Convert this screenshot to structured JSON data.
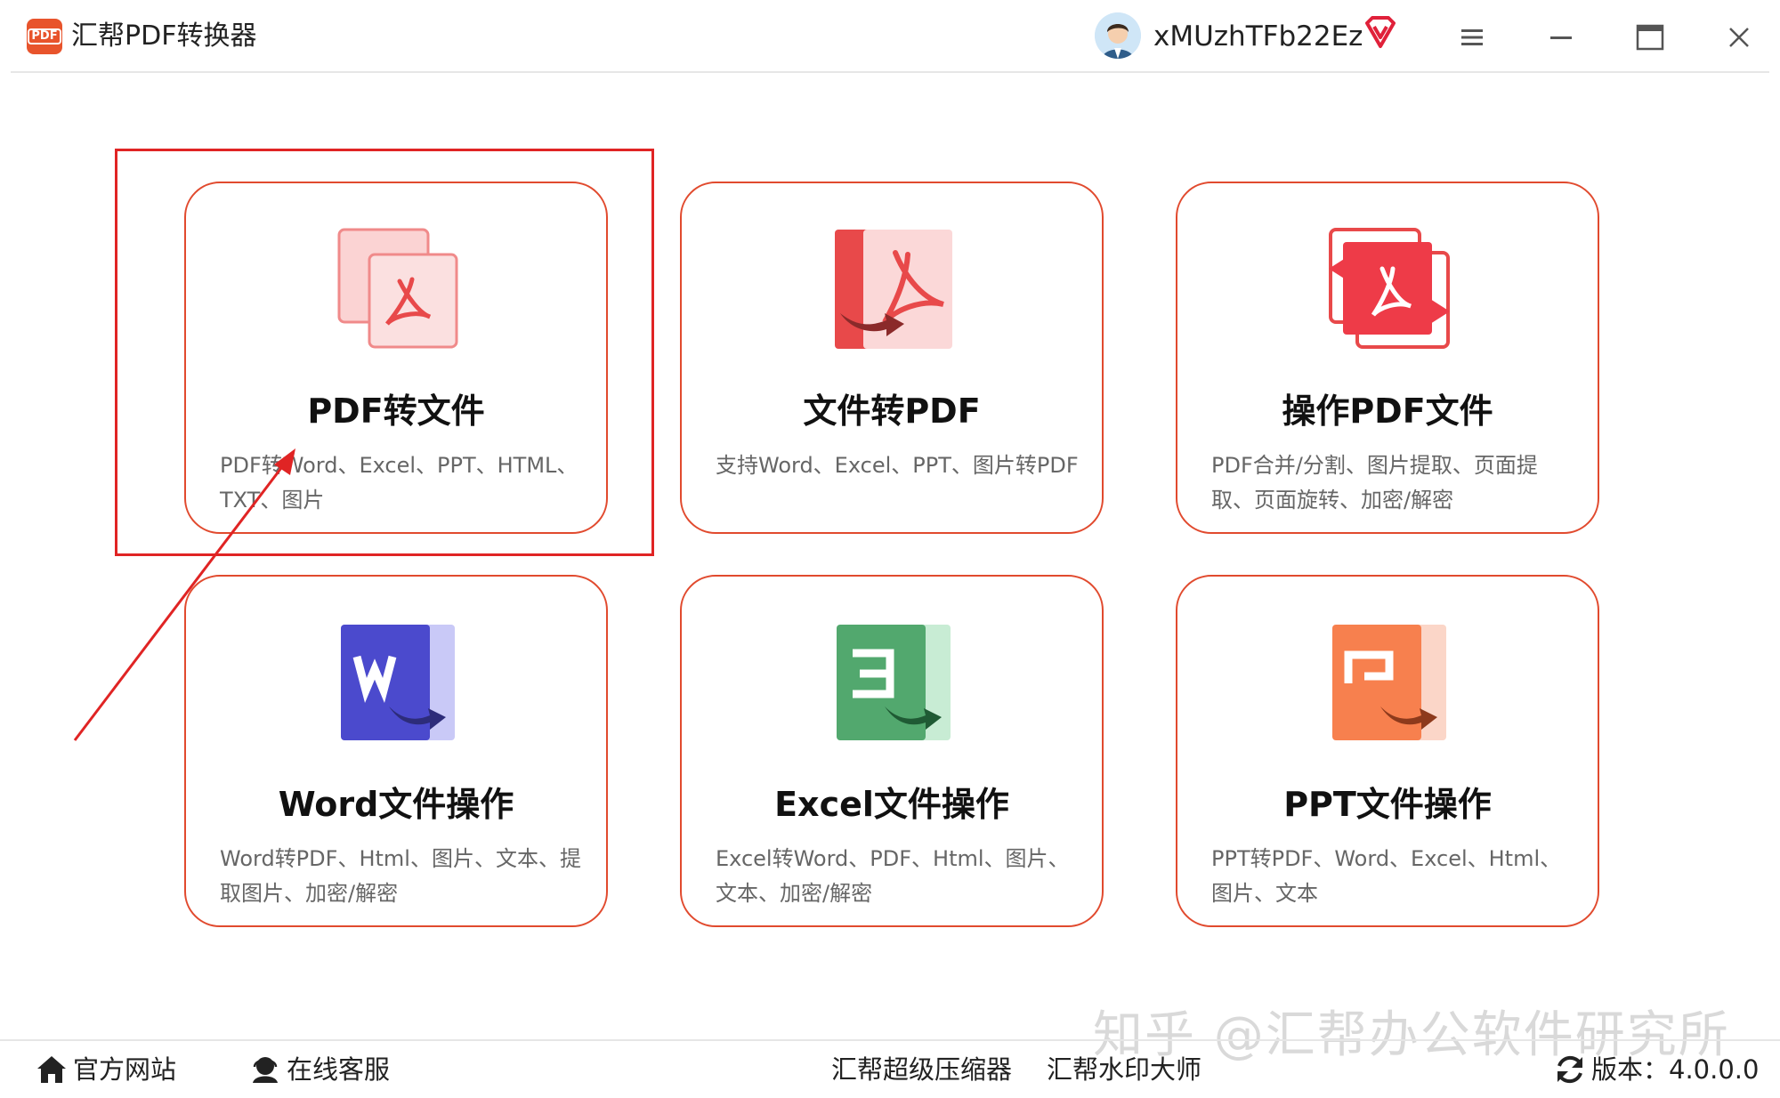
{
  "app": {
    "title": "汇帮PDF转换器",
    "logo_text": "PDF"
  },
  "user": {
    "name": "xMUzhTFb22Ez"
  },
  "window_controls": [
    "menu-icon",
    "minimize-icon",
    "maximize-icon",
    "close-icon"
  ],
  "colors": {
    "accent": "#e14a2e",
    "highlight": "#e02424"
  },
  "cards": [
    {
      "title": "PDF转文件",
      "desc": "PDF转Word、Excel、PPT、HTML、TXT、图片",
      "icon": "pdf-convert-icon"
    },
    {
      "title": "文件转PDF",
      "desc": "支持Word、Excel、PPT、图片转PDF",
      "icon": "file-to-pdf-icon"
    },
    {
      "title": "操作PDF文件",
      "desc": "PDF合并/分割、图片提取、页面提取、页面旋转、加密/解密",
      "icon": "pdf-operate-icon"
    },
    {
      "title": "Word文件操作",
      "desc": "Word转PDF、Html、图片、文本、提取图片、加密/解密",
      "icon": "word-icon"
    },
    {
      "title": "Excel文件操作",
      "desc": "Excel转Word、PDF、Html、图片、文本、加密/解密",
      "icon": "excel-icon"
    },
    {
      "title": "PPT文件操作",
      "desc": "PPT转PDF、Word、Excel、Html、图片、文本",
      "icon": "ppt-icon"
    }
  ],
  "bottom": {
    "website": "官方网站",
    "service": "在线客服",
    "compressor": "汇帮超级压缩器",
    "watermark_tool": "汇帮水印大师",
    "version": "版本：4.0.0.0"
  },
  "watermark": "知乎 @汇帮办公软件研究所"
}
